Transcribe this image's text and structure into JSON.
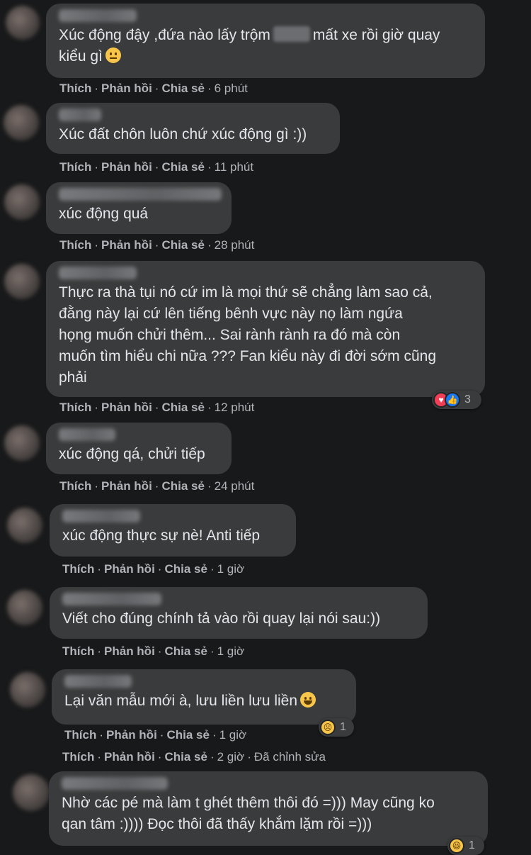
{
  "actions": {
    "like": "Thích",
    "reply": "Phản hồi",
    "share": "Chia sẻ",
    "dot": "·"
  },
  "comments": [
    {
      "text_a": "Xúc động đậy ,đứa nào lấy trộm",
      "text_b": "mất xe rồi giờ quay\nkiểu gì",
      "emoji": "neutral-face-icon",
      "time": "6 phút"
    },
    {
      "text": "Xúc đất chôn luôn chứ xúc động gì :))",
      "time": "11 phút"
    },
    {
      "text": "xúc động quá",
      "time": "28 phút"
    },
    {
      "text": "Thực ra thà tụi nó cứ im là mọi thứ sẽ chẳng làm sao cả,\nđằng này lại cứ lên tiếng bênh vực này nọ làm ngứa\nhọng muốn chửi thêm... Sai rành rành ra đó mà còn\nmuốn tìm hiểu chi nữa ??? Fan kiểu này đi đời sớm cũng\nphải",
      "time": "12 phút",
      "reactions": {
        "icons": [
          "heart-icon",
          "like-icon"
        ],
        "count": "3"
      }
    },
    {
      "text": "xúc động qá, chửi tiếp",
      "time": "24 phút"
    },
    {
      "text": "xúc động thực sự nè! Anti tiếp",
      "time": "1 giờ"
    },
    {
      "text": "Viết cho đúng chính tả vào rồi quay lại nói sau:))",
      "time": "1 giờ"
    },
    {
      "text": "Lại văn mẫu mới à, lưu liền lưu liền",
      "emoji": "grinning-face-icon",
      "time": "1 giờ",
      "reactions": {
        "icons": [
          "sad-face-icon"
        ],
        "count": "1"
      }
    },
    {
      "time": "2 giờ",
      "edited": "Đã chỉnh sửa"
    },
    {
      "text": "Nhờ các pé mà làm t ghét thêm thôi đó =))) May cũng ko\nqan tâm :)))) Đọc thôi đã thấy khắm lặm rồi =)))",
      "reactions": {
        "icons": [
          "haha-face-icon"
        ],
        "count": "1"
      }
    }
  ]
}
